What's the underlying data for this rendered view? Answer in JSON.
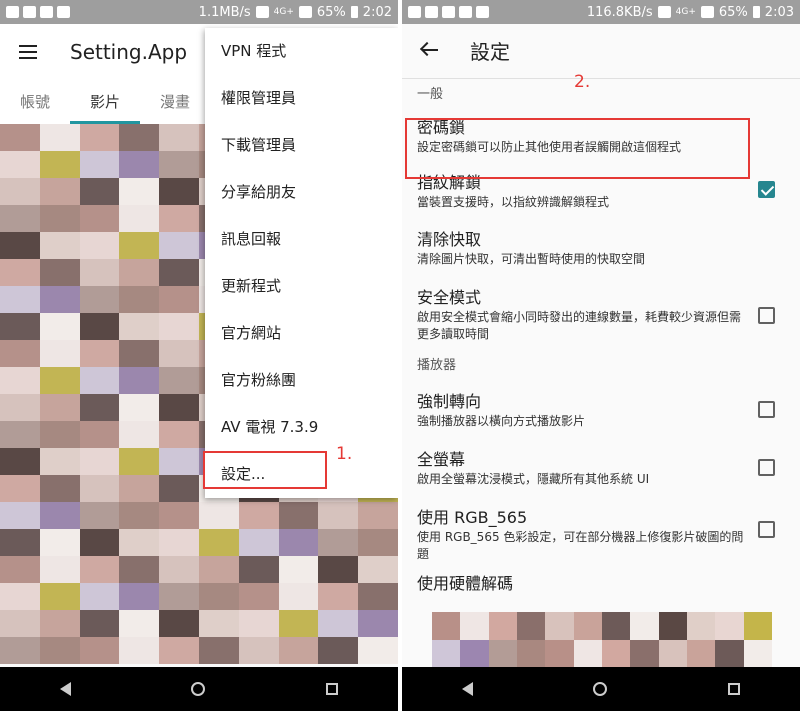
{
  "left": {
    "status": {
      "speed": "1.1MB/s",
      "network": "4G+",
      "battery": "65%",
      "time": "2:02"
    },
    "app_title": "Setting.App",
    "tabs": [
      {
        "label": "帳號"
      },
      {
        "label": "影片"
      },
      {
        "label": "漫畫"
      }
    ],
    "menu": [
      {
        "label": "VPN 程式"
      },
      {
        "label": "權限管理員"
      },
      {
        "label": "下載管理員"
      },
      {
        "label": "分享給朋友"
      },
      {
        "label": "訊息回報"
      },
      {
        "label": "更新程式"
      },
      {
        "label": "官方網站"
      },
      {
        "label": "官方粉絲團"
      },
      {
        "label": "AV 電視 7.3.9"
      },
      {
        "label": "設定..."
      }
    ],
    "annotation": "1."
  },
  "right": {
    "status": {
      "speed": "116.8KB/s",
      "network": "4G+",
      "battery": "65%",
      "time": "2:03"
    },
    "title": "設定",
    "annotation": "2.",
    "category_general": "一般",
    "category_player": "播放器",
    "prefs": [
      {
        "title": "密碼鎖",
        "summary": "設定密碼鎖可以防止其他使用者誤觸開啟這個程式",
        "checkbox": false,
        "checked": false
      },
      {
        "title": "指紋解鎖",
        "summary": "當裝置支援時，以指紋辨識解鎖程式",
        "checkbox": true,
        "checked": true
      },
      {
        "title": "清除快取",
        "summary": "清除圖片快取，可清出暫時使用的快取空間",
        "checkbox": false,
        "checked": false
      },
      {
        "title": "安全模式",
        "summary": "啟用安全模式會縮小同時發出的連線數量，耗費較少資源但需更多讀取時間",
        "checkbox": true,
        "checked": false
      },
      {
        "title": "強制轉向",
        "summary": "強制播放器以橫向方式播放影片",
        "checkbox": true,
        "checked": false
      },
      {
        "title": "全螢幕",
        "summary": "啟用全螢幕沈浸模式，隱藏所有其他系統 UI",
        "checkbox": true,
        "checked": false
      },
      {
        "title": "使用 RGB_565",
        "summary": "使用 RGB_565 色彩設定，可在部分機器上修復影片破圖的問題",
        "checkbox": true,
        "checked": false
      },
      {
        "title": "使用硬體解碼",
        "summary": "",
        "checkbox": false,
        "checked": false
      }
    ]
  },
  "colors": {
    "accent": "#26868f",
    "annotation_red": "#e53935"
  }
}
